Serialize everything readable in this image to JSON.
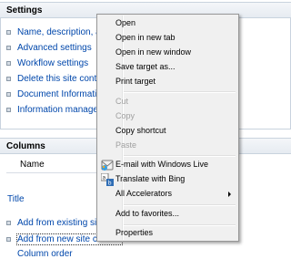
{
  "settings": {
    "title": "Settings",
    "links": [
      "Name, description, and navigation",
      "Advanced settings",
      "Workflow settings",
      "Delete this site content type",
      "Document Information Panel settings",
      "Information management policy settings"
    ]
  },
  "columns": {
    "title": "Columns",
    "name_header": "Name",
    "rows": [
      "Title"
    ],
    "links": [
      "Add from existing site columns",
      "Add from new site column"
    ],
    "cut_text": "Column order"
  },
  "context_menu": {
    "items": [
      {
        "label": "Open",
        "disabled": false
      },
      {
        "label": "Open in new tab",
        "disabled": false
      },
      {
        "label": "Open in new window",
        "disabled": false
      },
      {
        "label": "Save target as...",
        "disabled": false
      },
      {
        "label": "Print target",
        "disabled": false
      },
      {
        "label": "Cut",
        "disabled": true
      },
      {
        "label": "Copy",
        "disabled": true
      },
      {
        "label": "Copy shortcut",
        "disabled": false
      },
      {
        "label": "Paste",
        "disabled": true
      },
      {
        "label": "E-mail with Windows Live",
        "icon": "windows-live-icon",
        "disabled": false
      },
      {
        "label": "Translate with Bing",
        "icon": "translate-icon",
        "disabled": false
      },
      {
        "label": "All Accelerators",
        "submenu": true,
        "disabled": false
      },
      {
        "label": "Add to favorites...",
        "disabled": false
      },
      {
        "label": "Properties",
        "disabled": false
      }
    ]
  },
  "colors": {
    "link": "#0047ab",
    "header_bg": "#e6ebf1",
    "menu_bg": "#f0f0f0",
    "disabled_text": "#a0a0a0"
  }
}
